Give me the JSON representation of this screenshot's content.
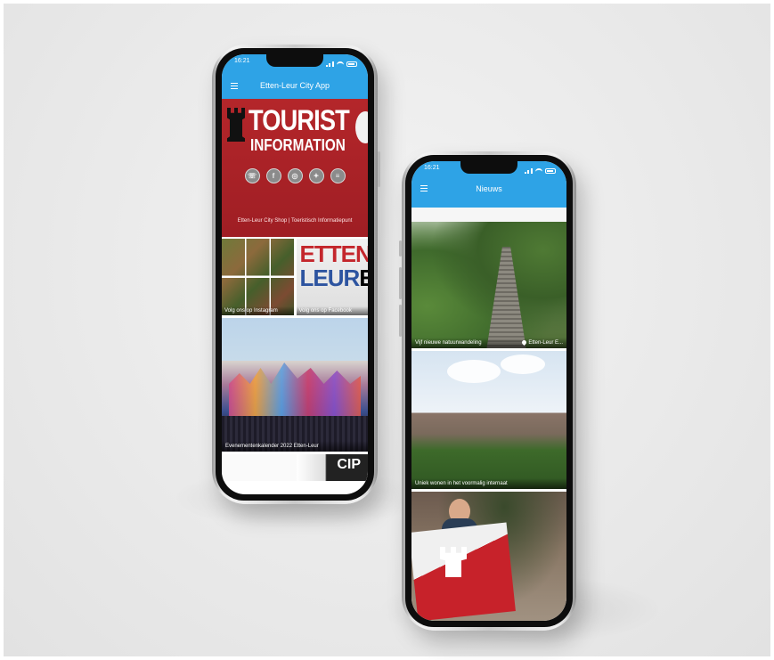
{
  "left_phone": {
    "status_time": "16:21",
    "app_title": "Etten-Leur City App",
    "banner": {
      "line1": "TOURIST",
      "line2": "INFORMATION",
      "caption": "Etten-Leur City Shop | Toeristisch Informatiepunt"
    },
    "social_icons": [
      "phone-icon",
      "facebook-icon",
      "instagram-icon",
      "twitter-icon",
      "website-icon"
    ],
    "tiles": [
      {
        "label": "Volg ons op Instagram"
      },
      {
        "label": "Volg ons op Facebook",
        "letters": [
          "ETTEN",
          "LEUR",
          "N",
          "EU"
        ]
      }
    ],
    "event": {
      "label": "Evenementenkalender 2022 Etten-Leur"
    },
    "peek_text": "CIP"
  },
  "right_phone": {
    "status_time": "16:21",
    "app_title": "Nieuws",
    "news": [
      {
        "title": "Vijf nieuwe natuurwandeling",
        "location": "Etten-Leur E..."
      },
      {
        "title": "Uniek wonen in het voormalig internaat",
        "location": ""
      },
      {
        "title": "",
        "location": ""
      }
    ]
  }
}
